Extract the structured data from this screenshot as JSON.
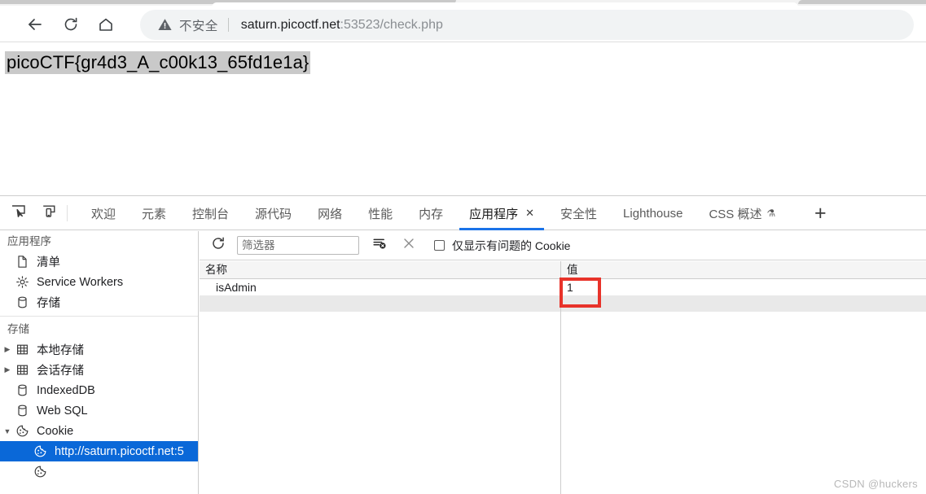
{
  "browser": {
    "nav": {
      "back_icon": "back-arrow-icon",
      "reload_icon": "reload-icon",
      "home_icon": "home-icon"
    },
    "omnibox": {
      "security_icon": "warning-triangle-icon",
      "security_label": "不安全",
      "url_host": "saturn.picoctf.net",
      "url_rest": ":53523/check.php",
      "url_full": "saturn.picoctf.net:53523/check.php"
    }
  },
  "page": {
    "flag_text": "picoCTF{gr4d3_A_c00k13_65fd1e1a}",
    "selection_color": "#c9c9c9"
  },
  "devtools": {
    "toolbar": {
      "inspect_icon": "inspect-element-icon",
      "device_icon": "device-toolbar-icon",
      "add_panel_label": "+"
    },
    "tabs": [
      {
        "label": "欢迎",
        "active": false,
        "closable": false,
        "experimental": false
      },
      {
        "label": "元素",
        "active": false,
        "closable": false,
        "experimental": false
      },
      {
        "label": "控制台",
        "active": false,
        "closable": false,
        "experimental": false
      },
      {
        "label": "源代码",
        "active": false,
        "closable": false,
        "experimental": false
      },
      {
        "label": "网络",
        "active": false,
        "closable": false,
        "experimental": false
      },
      {
        "label": "性能",
        "active": false,
        "closable": false,
        "experimental": false
      },
      {
        "label": "内存",
        "active": false,
        "closable": false,
        "experimental": false
      },
      {
        "label": "应用程序",
        "active": true,
        "closable": true,
        "experimental": false,
        "close_label": "✕"
      },
      {
        "label": "安全性",
        "active": false,
        "closable": false,
        "experimental": false
      },
      {
        "label": "Lighthouse",
        "active": false,
        "closable": false,
        "experimental": false
      },
      {
        "label": "CSS 概述",
        "active": false,
        "closable": false,
        "experimental": true,
        "flask_label": "⚗"
      }
    ],
    "active_tab_accent": "#1a73e8",
    "sidebar": {
      "sections": [
        {
          "title": "应用程序",
          "items": [
            {
              "label": "清单",
              "icon": "document-icon",
              "arrow": "none",
              "selected": false
            },
            {
              "label": "Service Workers",
              "icon": "gear-icon",
              "arrow": "none",
              "selected": false
            },
            {
              "label": "存储",
              "icon": "database-icon",
              "arrow": "none",
              "selected": false
            }
          ]
        },
        {
          "title": "存储",
          "items": [
            {
              "label": "本地存储",
              "icon": "grid-icon",
              "arrow": "collapsed",
              "selected": false
            },
            {
              "label": "会话存储",
              "icon": "grid-icon",
              "arrow": "collapsed",
              "selected": false
            },
            {
              "label": "IndexedDB",
              "icon": "database-icon",
              "arrow": "none",
              "selected": false
            },
            {
              "label": "Web SQL",
              "icon": "database-icon",
              "arrow": "none",
              "selected": false
            },
            {
              "label": "Cookie",
              "icon": "cookie-icon",
              "arrow": "expanded",
              "selected": false
            },
            {
              "label": "http://saturn.picoctf.net:5",
              "icon": "cookie-icon",
              "arrow": "none",
              "selected": true,
              "indent": true
            },
            {
              "label": "",
              "icon": "cookie-icon",
              "arrow": "none",
              "selected": false,
              "indent": true
            }
          ]
        }
      ],
      "selected_bg": "#0a68d8"
    },
    "cookie_panel": {
      "toolbar": {
        "refresh_icon": "refresh-icon",
        "filter_placeholder": "筛选器",
        "filter_value": "",
        "clear_filter_icon": "clear-filter-icon",
        "clear_all_icon": "close-x-icon",
        "problem_cookies_label": "仅显示有问题的 Cookie",
        "problem_cookies_checked": false
      },
      "table": {
        "columns": [
          "名称",
          "值"
        ],
        "rows": [
          {
            "名称": "isAdmin",
            "值": "1"
          }
        ]
      }
    }
  },
  "annotation": {
    "highlight_color": "#e8332a",
    "target": "cookie-value-cell"
  },
  "watermark": "CSDN @huckers"
}
